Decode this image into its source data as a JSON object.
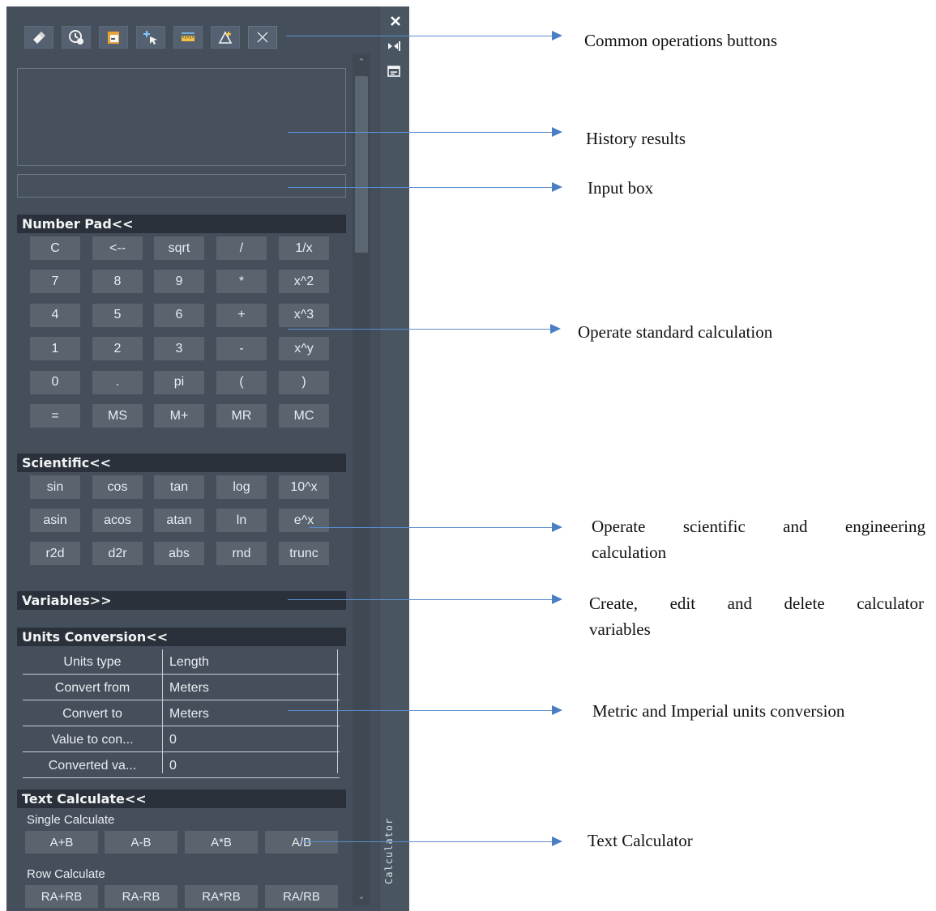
{
  "panel": {
    "side_label": "Calculator",
    "toolbar_icons": [
      "eraser-icon",
      "history-clear-icon",
      "paste-icon",
      "pick-point-icon",
      "measure-distance-icon",
      "measure-angle-icon",
      "close-x-icon"
    ],
    "right_icons": [
      "close-icon",
      "dock-toggle-icon",
      "properties-icon"
    ],
    "input_value": ""
  },
  "number_pad": {
    "title": "Number Pad<<",
    "rows": [
      [
        "C",
        "<--",
        "sqrt",
        "/",
        "1/x"
      ],
      [
        "7",
        "8",
        "9",
        "*",
        "x^2"
      ],
      [
        "4",
        "5",
        "6",
        "+",
        "x^3"
      ],
      [
        "1",
        "2",
        "3",
        "-",
        "x^y"
      ],
      [
        "0",
        ".",
        "pi",
        "(",
        ")"
      ],
      [
        "=",
        "MS",
        "M+",
        "MR",
        "MC"
      ]
    ]
  },
  "scientific": {
    "title": "Scientific<<",
    "rows": [
      [
        "sin",
        "cos",
        "tan",
        "log",
        "10^x"
      ],
      [
        "asin",
        "acos",
        "atan",
        "ln",
        "e^x"
      ],
      [
        "r2d",
        "d2r",
        "abs",
        "rnd",
        "trunc"
      ]
    ]
  },
  "variables": {
    "title": "Variables>>"
  },
  "units": {
    "title": "Units Conversion<<",
    "rows": [
      {
        "name": "Units type",
        "value": "Length"
      },
      {
        "name": "Convert from",
        "value": "Meters"
      },
      {
        "name": "Convert to",
        "value": "Meters"
      },
      {
        "name": "Value to con...",
        "value": "0"
      },
      {
        "name": "Converted va...",
        "value": "0"
      }
    ]
  },
  "text_calc": {
    "title": "Text Calculate<<",
    "single_label": "Single Calculate",
    "single": [
      "A+B",
      "A-B",
      "A*B",
      "A/B"
    ],
    "row_label": "Row Calculate",
    "row": [
      "RA+RB",
      "RA-RB",
      "RA*RB",
      "RA/RB"
    ]
  },
  "annotations": {
    "common_ops": "Common operations buttons",
    "history": "History results",
    "input": "Input box",
    "standard": "Operate standard calculation",
    "scientific_1": "Operate scientific and engineering",
    "scientific_2": "calculation",
    "variables_1": "Create, edit and delete calculator",
    "variables_2": "variables",
    "units": "Metric and Imperial units conversion",
    "text_calc": "Text Calculator"
  },
  "colors": {
    "panel_bg": "#454f5c",
    "section_header": "#2b313a",
    "key_bg": "#59646f",
    "arrow": "#4a7ec4"
  }
}
